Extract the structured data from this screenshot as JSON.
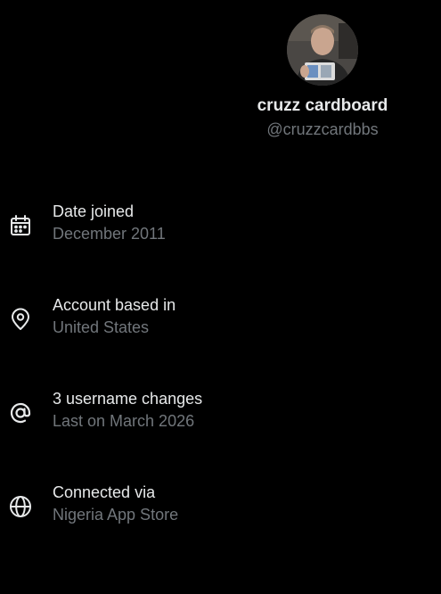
{
  "profile": {
    "display_name": "cruzz cardboard",
    "handle": "@cruzzcardbbs"
  },
  "info_items": [
    {
      "icon": "calendar-icon",
      "title": "Date joined",
      "subtitle": "December 2011"
    },
    {
      "icon": "location-pin-icon",
      "title": "Account based in",
      "subtitle": "United States"
    },
    {
      "icon": "at-sign-icon",
      "title": "3 username changes",
      "subtitle": "Last on March 2026"
    },
    {
      "icon": "globe-icon",
      "title": "Connected via",
      "subtitle": "Nigeria App Store"
    }
  ],
  "colors": {
    "background": "#000000",
    "primary_text": "#e7e9ea",
    "secondary_text": "#71767b"
  }
}
